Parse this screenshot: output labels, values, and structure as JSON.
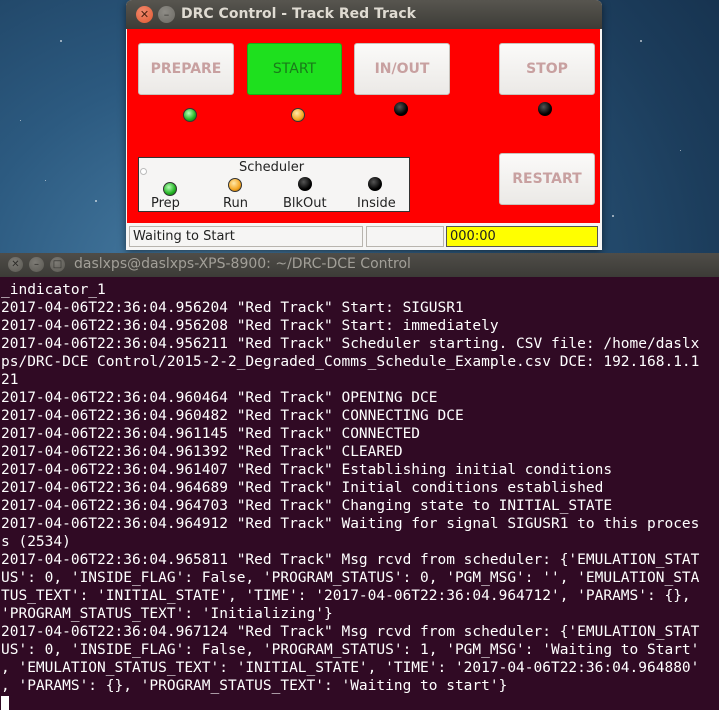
{
  "drc_window": {
    "title": "DRC Control - Track Red Track",
    "buttons": {
      "prepare": "PREPARE",
      "start": "START",
      "in_out": "IN/OUT",
      "stop": "STOP",
      "restart": "RESTART"
    },
    "scheduler": {
      "title": "Scheduler",
      "labels": [
        "Prep",
        "Run",
        "BlkOut",
        "Inside"
      ]
    },
    "status": {
      "message": "Waiting to Start",
      "middle": "",
      "timer": "000:00"
    },
    "colors": {
      "panel": "#ff0000",
      "start_button": "#1ee01e",
      "timer_bg": "#ffff00",
      "led_green": "#22b322",
      "led_orange": "#f5a623",
      "led_off": "#000000"
    }
  },
  "terminal": {
    "title": "daslxps@daslxps-XPS-8900: ~/DRC-DCE Control",
    "lines": [
      "_indicator_1",
      "2017-04-06T22:36:04.956204 \"Red Track\" Start: SIGUSR1",
      "2017-04-06T22:36:04.956208 \"Red Track\" Start: immediately",
      "2017-04-06T22:36:04.956211 \"Red Track\" Scheduler starting. CSV file: /home/daslx",
      "ps/DRC-DCE Control/2015-2-2_Degraded_Comms_Schedule_Example.csv DCE: 192.168.1.1",
      "21",
      "2017-04-06T22:36:04.960464 \"Red Track\" OPENING DCE",
      "2017-04-06T22:36:04.960482 \"Red Track\" CONNECTING DCE",
      "2017-04-06T22:36:04.961145 \"Red Track\" CONNECTED",
      "2017-04-06T22:36:04.961392 \"Red Track\" CLEARED",
      "2017-04-06T22:36:04.961407 \"Red Track\" Establishing initial conditions",
      "2017-04-06T22:36:04.964689 \"Red Track\" Initial conditions established",
      "2017-04-06T22:36:04.964703 \"Red Track\" Changing state to INITIAL_STATE",
      "2017-04-06T22:36:04.964912 \"Red Track\" Waiting for signal SIGUSR1 to this proces",
      "s (2534)",
      "2017-04-06T22:36:04.965811 \"Red Track\" Msg rcvd from scheduler: {'EMULATION_STAT",
      "US': 0, 'INSIDE_FLAG': False, 'PROGRAM_STATUS': 0, 'PGM_MSG': '', 'EMULATION_STA",
      "TUS_TEXT': 'INITIAL_STATE', 'TIME': '2017-04-06T22:36:04.964712', 'PARAMS': {},",
      "'PROGRAM_STATUS_TEXT': 'Initializing'}",
      "2017-04-06T22:36:04.967124 \"Red Track\" Msg rcvd from scheduler: {'EMULATION_STAT",
      "US': 0, 'INSIDE_FLAG': False, 'PROGRAM_STATUS': 1, 'PGM_MSG': 'Waiting to Start'",
      ", 'EMULATION_STATUS_TEXT': 'INITIAL_STATE', 'TIME': '2017-04-06T22:36:04.964880'",
      ", 'PARAMS': {}, 'PROGRAM_STATUS_TEXT': 'Waiting to start'}"
    ],
    "colors": {
      "background": "#300a24",
      "text": "#ffffff"
    }
  }
}
